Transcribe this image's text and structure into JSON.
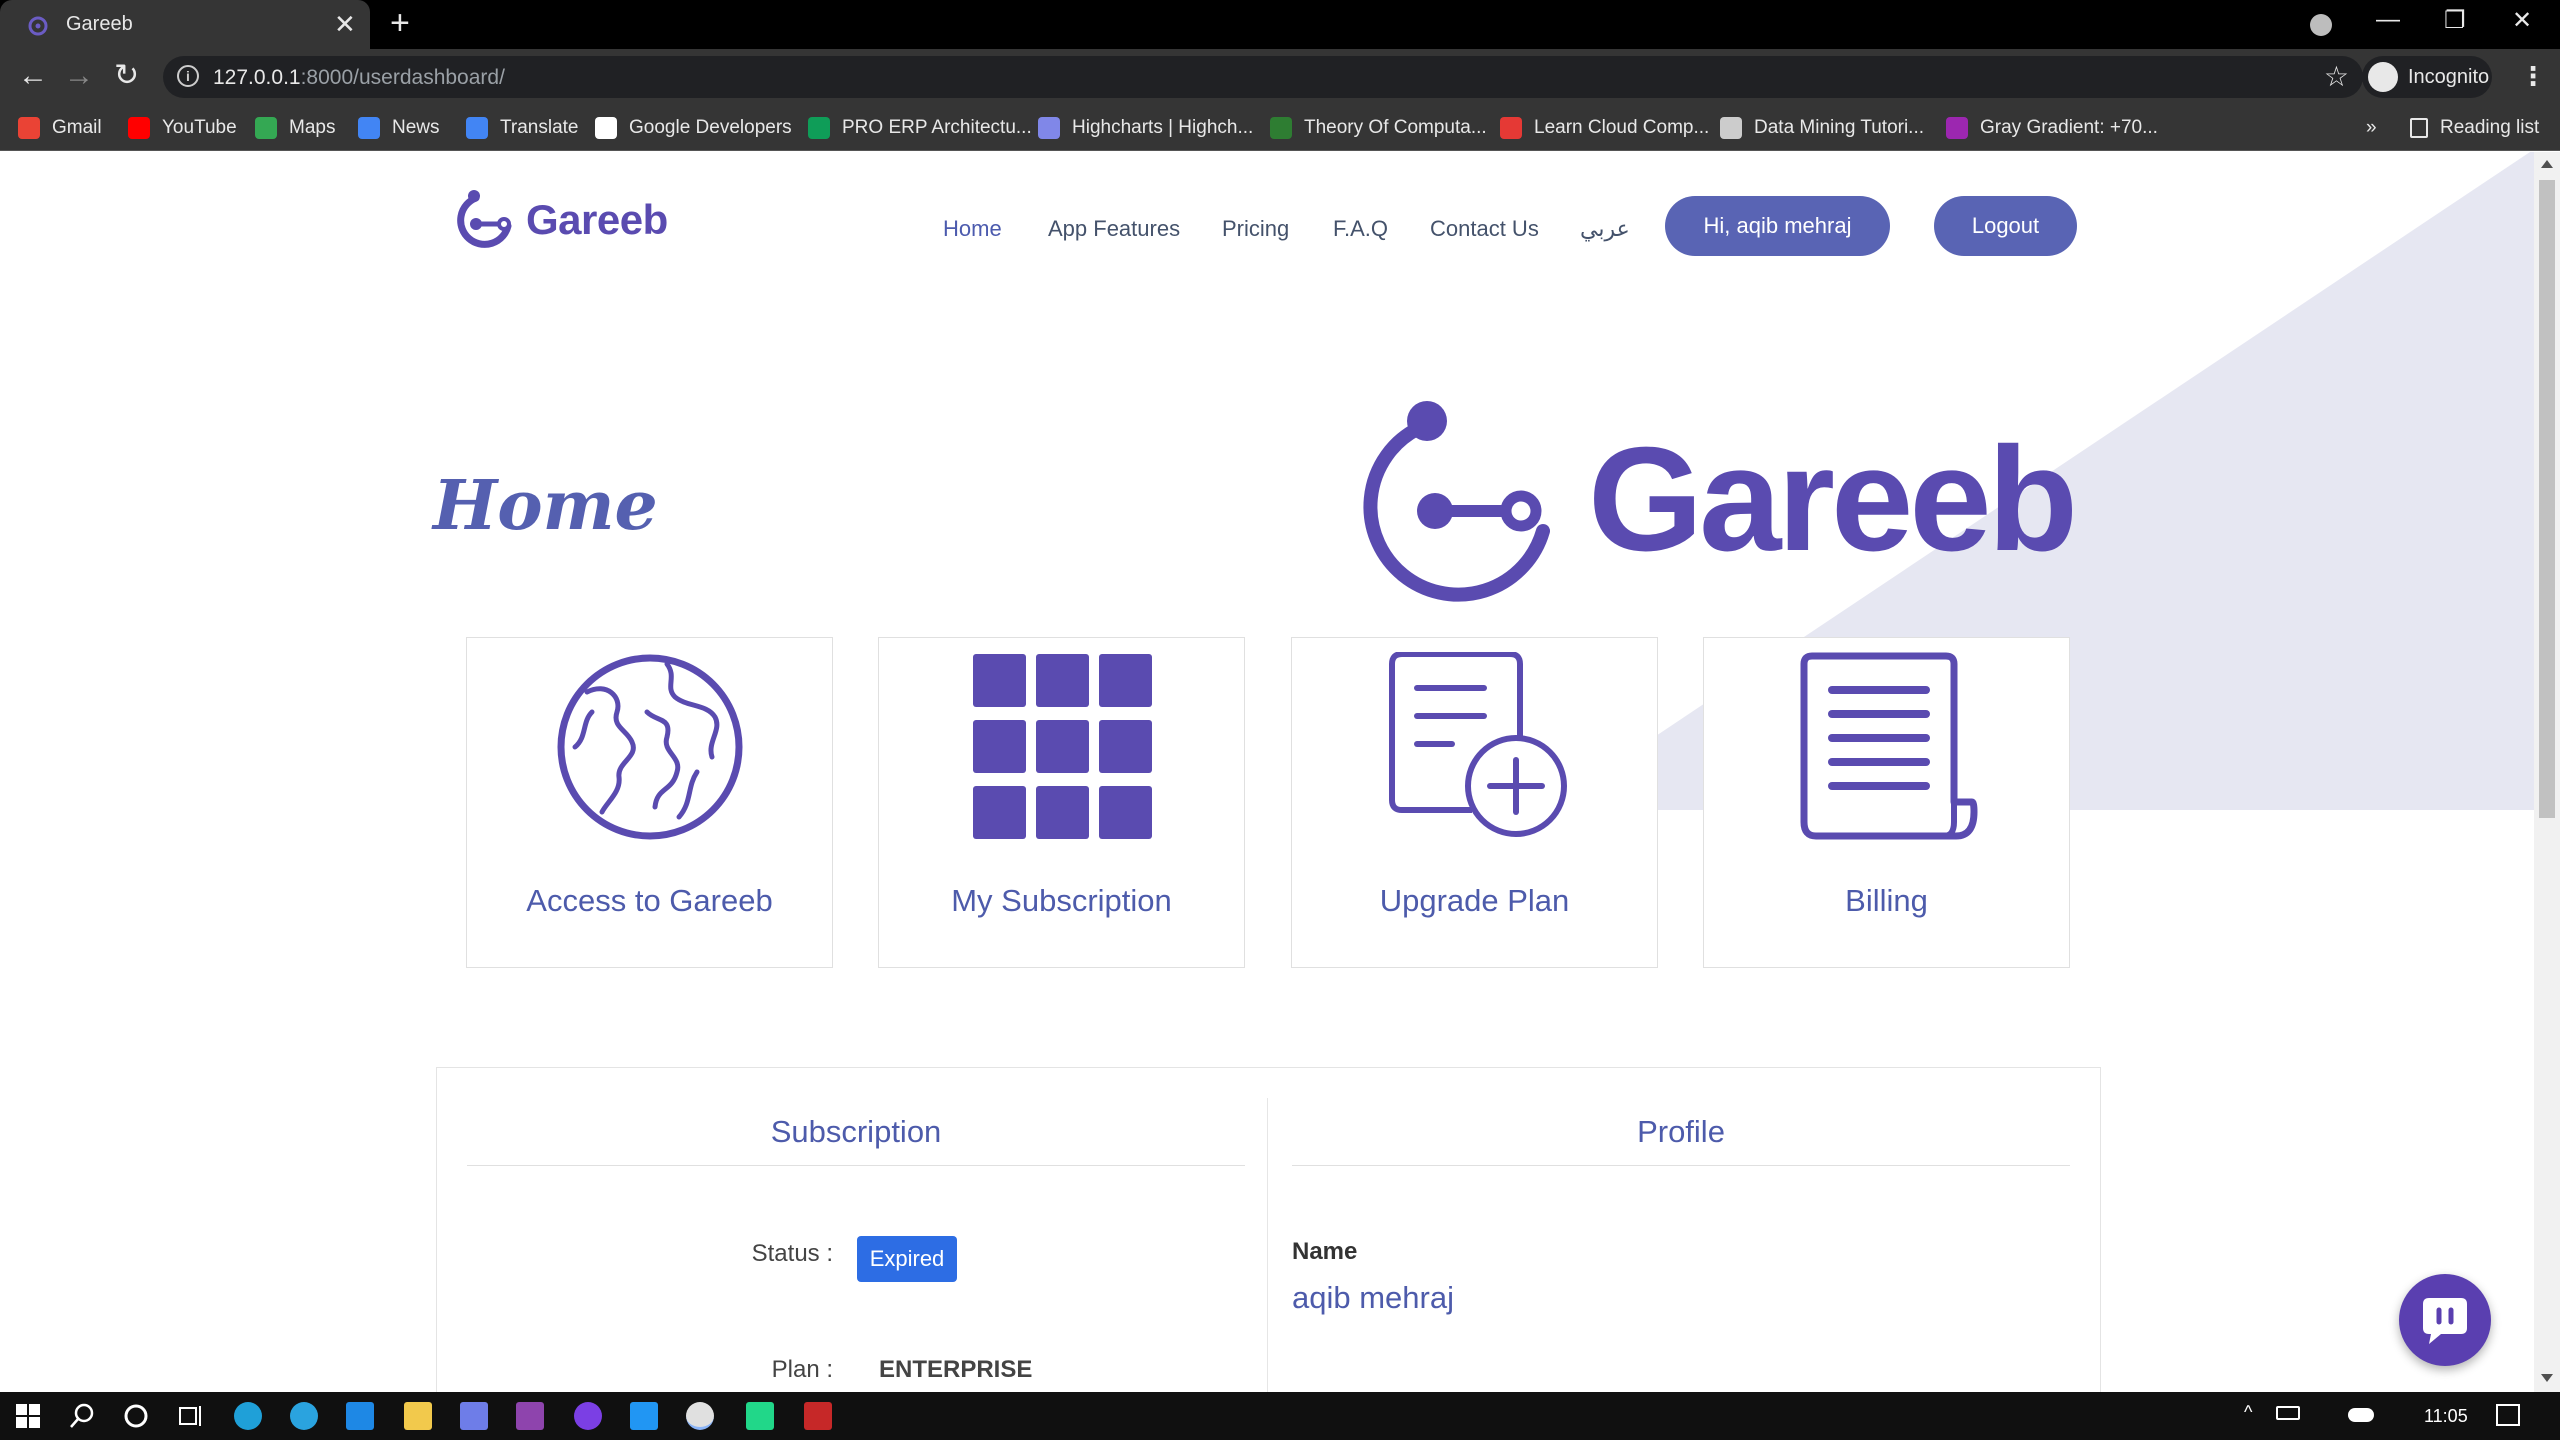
{
  "browser": {
    "tab_title": "Gareeb",
    "tab_close": "✕",
    "new_tab": "+",
    "url_host": "127.0.0.1",
    "url_path": ":8000/userdashboard/",
    "incognito_label": "Incognito",
    "reading_list": "Reading list",
    "more_bookmarks": "»",
    "bookmarks": [
      {
        "label": "Gmail",
        "color": "#ea4335"
      },
      {
        "label": "YouTube",
        "color": "#ff0000"
      },
      {
        "label": "Maps",
        "color": "#34a853"
      },
      {
        "label": "News",
        "color": "#4285f4"
      },
      {
        "label": "Translate",
        "color": "#4285f4"
      },
      {
        "label": "Google Developers",
        "color": "#ffffff"
      },
      {
        "label": "PRO ERP Architectu...",
        "color": "#0f9d58"
      },
      {
        "label": "Highcharts | Highch...",
        "color": "#8087e8"
      },
      {
        "label": "Theory Of Computa...",
        "color": "#2e7d32"
      },
      {
        "label": "Learn Cloud Comp...",
        "color": "#e53935"
      },
      {
        "label": "Data Mining Tutori...",
        "color": "#cccccc"
      },
      {
        "label": "Gray Gradient: +70...",
        "color": "#9c27b0"
      }
    ]
  },
  "site": {
    "brand": "Gareeb",
    "nav": [
      {
        "label": "Home",
        "active": true
      },
      {
        "label": "App Features"
      },
      {
        "label": "Pricing"
      },
      {
        "label": "F.A.Q"
      },
      {
        "label": "Contact Us"
      },
      {
        "label": "عربي"
      }
    ],
    "greeting_button": "Hi, aqib mehraj",
    "logout_button": "Logout",
    "page_title": "Home",
    "cards": [
      {
        "label": "Access to Gareeb",
        "icon": "globe-icon"
      },
      {
        "label": "My Subscription",
        "icon": "grid-icon"
      },
      {
        "label": "Upgrade Plan",
        "icon": "document-add-icon"
      },
      {
        "label": "Billing",
        "icon": "scroll-icon"
      }
    ],
    "subscription": {
      "heading": "Subscription",
      "status_label": "Status :",
      "status_value": "Expired",
      "plan_label": "Plan :",
      "plan_value": "ENTERPRISE"
    },
    "profile": {
      "heading": "Profile",
      "name_label": "Name",
      "name_value": "aqib mehraj"
    }
  },
  "colors": {
    "brand_purple": "#5a4bb0",
    "accent_blue": "#5964b4",
    "badge_blue": "#2d6de4",
    "bg_shape": "#e6e7f2"
  },
  "taskbar": {
    "clock": "11:05"
  }
}
